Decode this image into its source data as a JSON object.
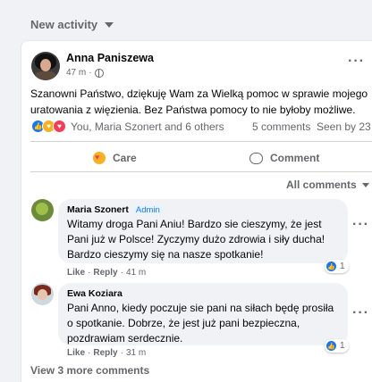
{
  "feed": {
    "section_title": "New activity"
  },
  "post": {
    "author": "Anna Paniszewa",
    "time": "47 m",
    "text": "Szanowni Państwo, dziękuję Wam za Wielką pomoc w sprawie mojego uratowania z więzienia. Bez Państwa pomocy to nie byłoby możliwe.",
    "reactions_text": "You, Maria Szonert and 6 others",
    "comments_count": "5 comments",
    "seen_by": "Seen by 23",
    "reaction_icons": [
      "like-icon",
      "care-icon",
      "love-icon"
    ]
  },
  "actions": {
    "care_label": "Care",
    "comment_label": "Comment"
  },
  "comments_filter": {
    "label": "All comments"
  },
  "comments": [
    {
      "name": "Maria Szonert",
      "badge": "Admin",
      "text": "Witamy droga Pani Aniu! Bardzo sie cieszymy, że jest Pani już w Polsce! Zyczymy dużo zdrowia i siły ducha! Bardzo cieszymy się na nasze spotkanie!",
      "like_label": "Like",
      "reply_label": "Reply",
      "time": "41 m",
      "like_count": "1"
    },
    {
      "name": "Ewa Koziara",
      "text": "Pani Anno, kiedy poczuje sie pani na siłach będę prosiła o spotkanie. Dobrze, że jest już pani bezpieczna, pozdrawiam serdecznie.",
      "like_label": "Like",
      "reply_label": "Reply",
      "time": "31 m",
      "like_count": "1"
    }
  ],
  "view_more": "View 3 more comments",
  "colors": {
    "accent": "#1877f2",
    "secondary_text": "#65676b",
    "bubble": "#f0f2f5"
  }
}
